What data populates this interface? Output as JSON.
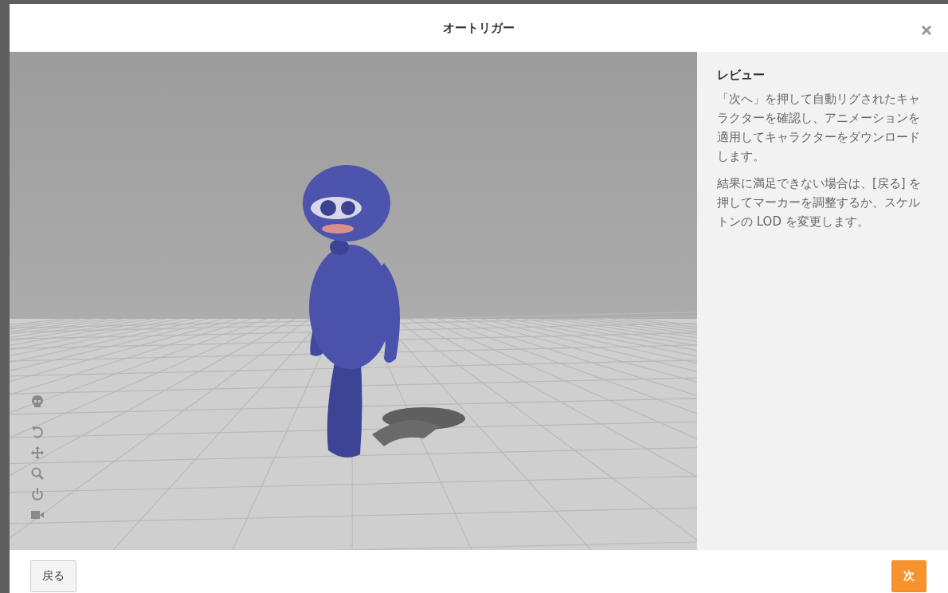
{
  "dialog": {
    "title": "オートリガー"
  },
  "panel": {
    "heading": "レビュー",
    "paragraphs": [
      "「次へ」を押して自動リグされたキャラクターを確認し、アニメーションを適用してキャラクターをダウンロードします。",
      "結果に満足できない場合は、[戻る] を押してマーカーを調整するか、スケルトンの LOD を変更します。"
    ]
  },
  "footer": {
    "back_button": "戻る",
    "next_button": "次"
  }
}
